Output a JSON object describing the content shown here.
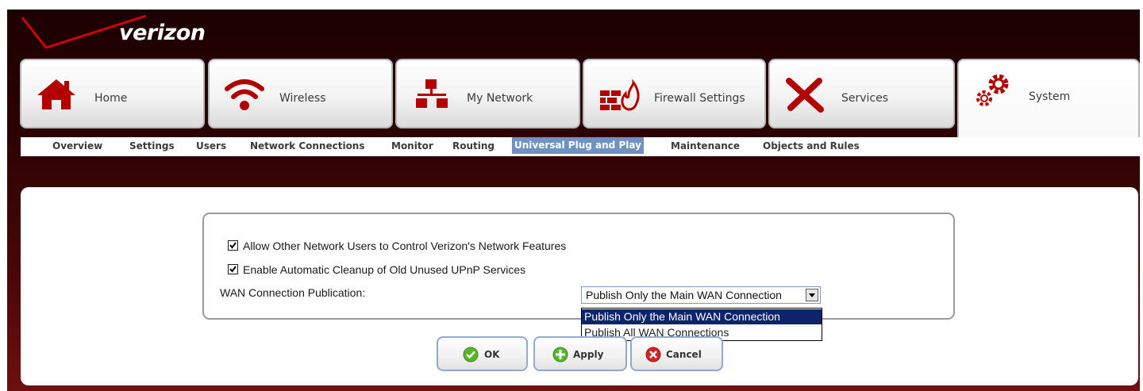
{
  "brand": {
    "logo_text": "verizon",
    "accent": "#cd040b"
  },
  "tabs": [
    {
      "label": "Home",
      "icon": "home-icon"
    },
    {
      "label": "Wireless",
      "icon": "wifi-icon"
    },
    {
      "label": "My Network",
      "icon": "network-icon"
    },
    {
      "label": "Firewall Settings",
      "icon": "firewall-icon"
    },
    {
      "label": "Services",
      "icon": "tools-icon"
    },
    {
      "label": "System",
      "icon": "gears-icon",
      "active": true
    }
  ],
  "subnav": [
    "Overview",
    "Settings",
    "Users",
    "Network Connections",
    "Monitor",
    "Routing",
    "Universal Plug and Play",
    "Maintenance",
    "Objects and Rules"
  ],
  "subnav_selected": "Universal Plug and Play",
  "upnp": {
    "allow_control_label": "Allow Other Network Users to Control Verizon's Network Features",
    "allow_control_checked": true,
    "cleanup_label": "Enable Automatic Cleanup of Old Unused UPnP Services",
    "cleanup_checked": true,
    "wan_label": "WAN Connection Publication:",
    "wan_value": "Publish Only the Main WAN Connection",
    "wan_options": [
      "Publish Only the Main WAN Connection",
      "Publish All WAN Connections"
    ]
  },
  "buttons": {
    "ok": "OK",
    "apply": "Apply",
    "cancel": "Cancel"
  }
}
